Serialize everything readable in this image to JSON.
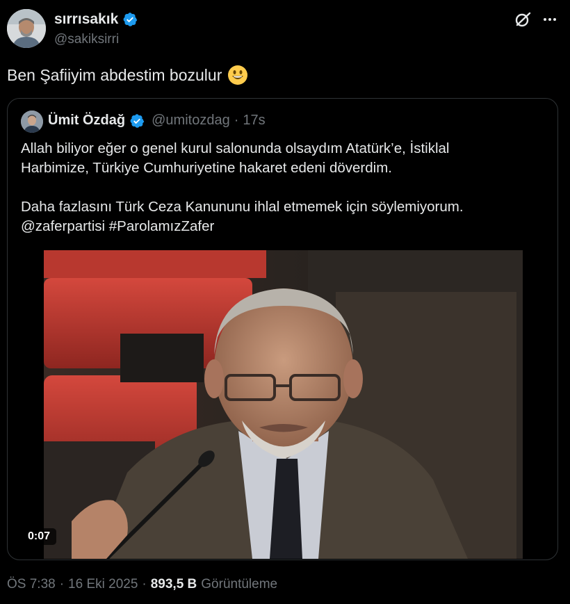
{
  "author": {
    "display_name": "sırrısakık",
    "handle": "@sakiksirri",
    "verified": true
  },
  "tweet": {
    "text": "Ben Şafiiyim abdestim bozulur",
    "emoji": "smiley-face"
  },
  "quoted": {
    "display_name": "Ümit Özdağ",
    "handle": "@umitozdag",
    "separator": "·",
    "time": "17s",
    "line1": "Allah biliyor eğer o genel kurul salonunda olsaydım Atatürk’e, İstiklal",
    "line2": "Harbimize, Türkiye Cumhuriyetine hakaret edeni döverdim.",
    "line3": "Daha fazlasını Türk Ceza Kanununu ihlal etmemek için söylemiyorum.",
    "mention": "@zaferpartisi",
    "hashtag": "#ParolamızZafer",
    "video_duration": "0:07"
  },
  "footer": {
    "time": "ÖS 7:38",
    "sep1": "·",
    "date": "16 Eki 2025",
    "sep2": "·",
    "views_count": "893,5 B",
    "views_label": "Görüntüleme"
  },
  "colors": {
    "background": "#000000",
    "text": "#e7e9ea",
    "secondary": "#71767b",
    "verified_badge": "#1d9bf0",
    "border": "#2f3336"
  },
  "icons": [
    "verified-badge-icon",
    "grok-icon",
    "more-options-icon",
    "smiley-emoji-icon"
  ]
}
